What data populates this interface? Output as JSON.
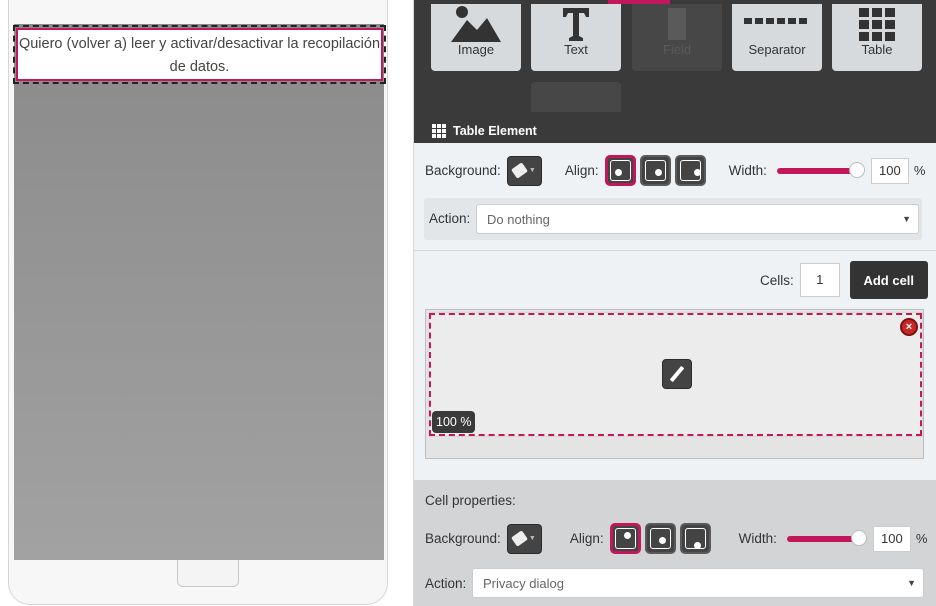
{
  "preview": {
    "text": "Quiero (volver a) leer y activar/desactivar la recopilación de datos."
  },
  "toolbar": {
    "tools": [
      {
        "label": "Image",
        "icon": "image-icon",
        "enabled": true
      },
      {
        "label": "Text",
        "icon": "text-icon",
        "enabled": true
      },
      {
        "label": "Field",
        "icon": "field-icon",
        "enabled": false
      },
      {
        "label": "Separator",
        "icon": "separator-icon",
        "enabled": true
      },
      {
        "label": "Table",
        "icon": "table-icon",
        "enabled": true
      }
    ],
    "section_title": "Table Element"
  },
  "table_element": {
    "background_label": "Background:",
    "align_label": "Align:",
    "width_label": "Width:",
    "width_value": "100",
    "width_unit": "%",
    "width_fraction": 1.0,
    "action_label": "Action:",
    "action_value": "Do nothing"
  },
  "cells_section": {
    "cells_label": "Cells:",
    "cells_value": "1",
    "add_button": "Add cell",
    "cell_width_badge": "100 %"
  },
  "cell_properties": {
    "title": "Cell properties:",
    "background_label": "Background:",
    "align_label": "Align:",
    "width_label": "Width:",
    "width_value": "100",
    "width_unit": "%",
    "width_fraction": 1.0,
    "action_label": "Action:",
    "action_value": "Privacy dialog"
  },
  "colors": {
    "accent": "#c2185b",
    "toolbar_bg": "#3a3a3a",
    "panel_bg": "#eef2f5"
  }
}
